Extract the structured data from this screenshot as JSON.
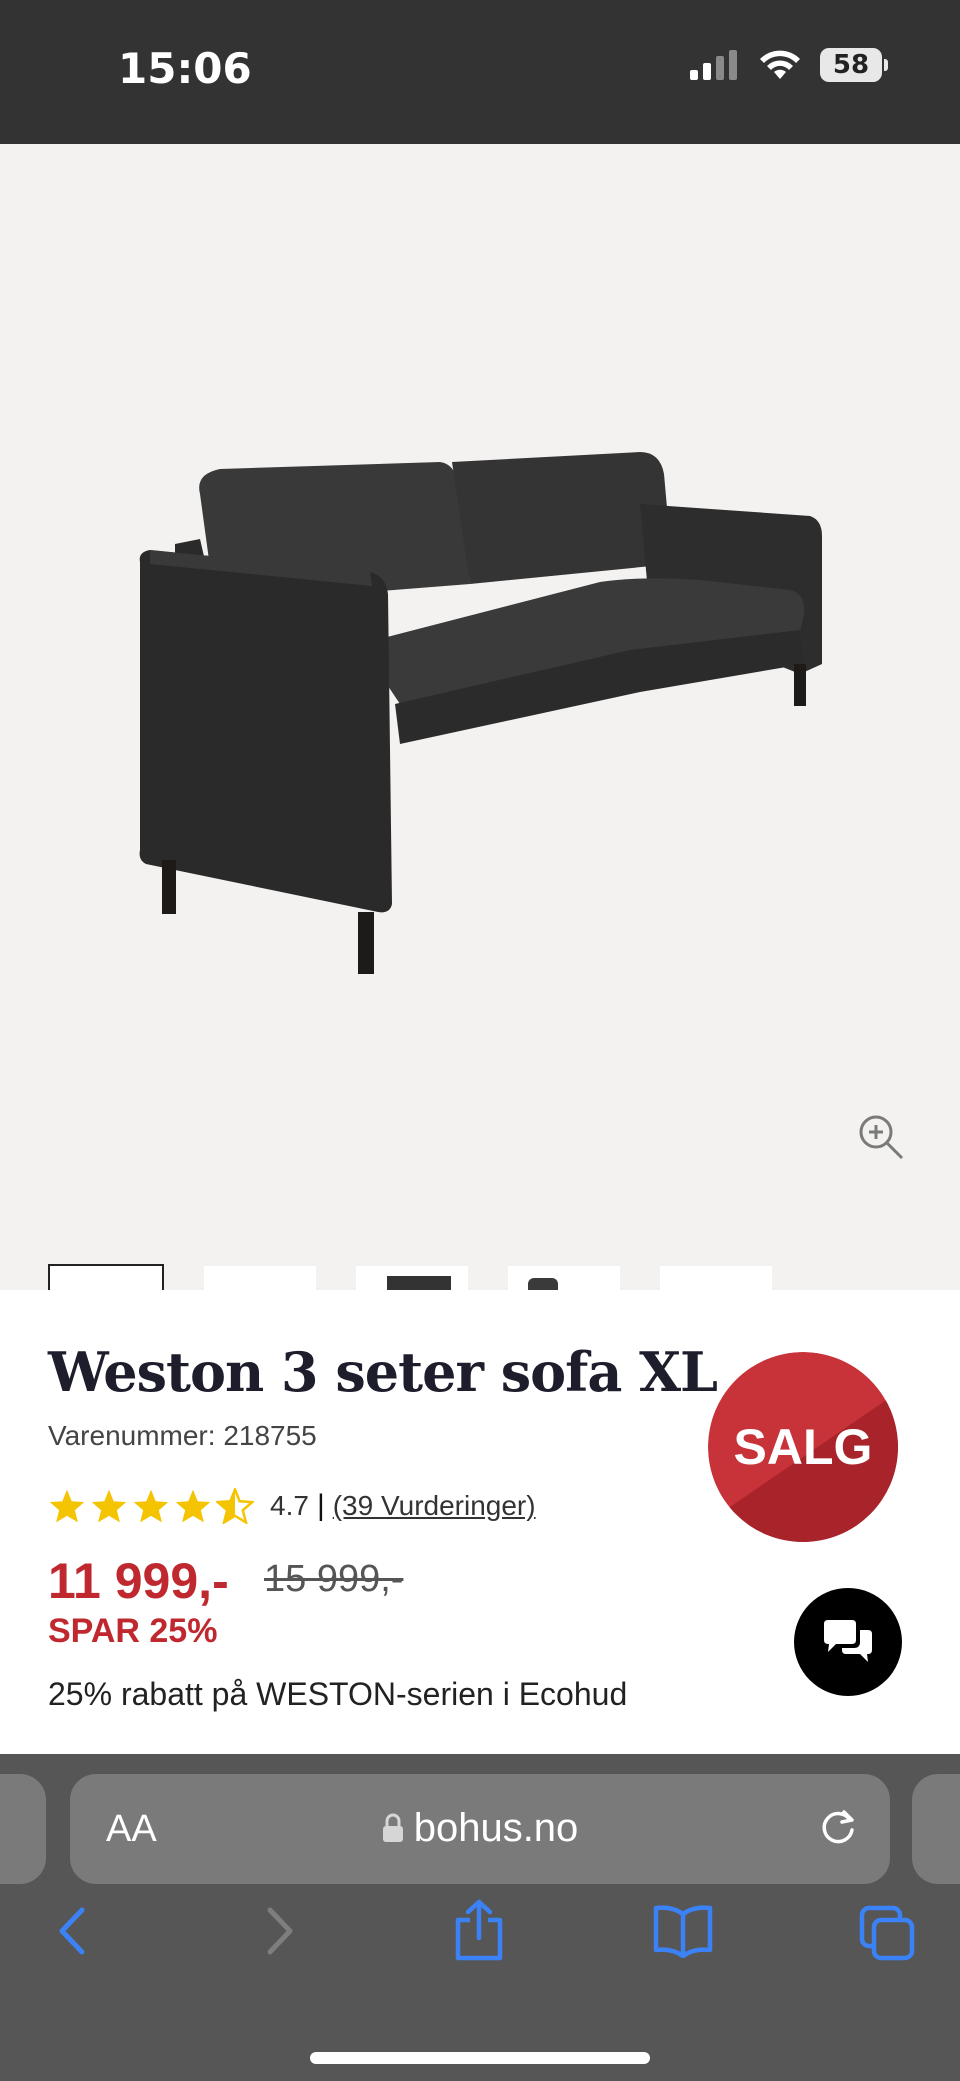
{
  "status_bar": {
    "time": "15:06",
    "battery": "58"
  },
  "product": {
    "title": "Weston 3 seter sofa XL",
    "sku": "Varenummer: 218755",
    "rating_value": "4.7",
    "rating_separator": "|",
    "rating_count_link": "(39 Vurderinger)",
    "price": "11 999,-",
    "old_price": "15 999,-",
    "savings": "SPAR 25%",
    "promo": "25% rabatt på WESTON-serien i Ecohud",
    "badge": "SALG"
  },
  "gallery": {
    "thumbnail_count": 5,
    "active_thumbnail": 1
  },
  "browser": {
    "text_size_label": "AA",
    "domain": "bohus.no"
  },
  "colors": {
    "accent_red": "#c0282f",
    "status_bar": "#333333",
    "safari_bar": "#565656",
    "link_blue": "#3b82f6"
  }
}
